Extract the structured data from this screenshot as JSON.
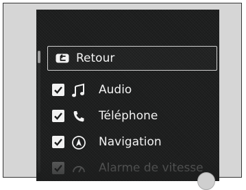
{
  "menu": {
    "back_label": "Retour",
    "items": [
      {
        "label": "Audio",
        "checked": true,
        "icon": "music-note-icon"
      },
      {
        "label": "Téléphone",
        "checked": true,
        "icon": "phone-icon"
      },
      {
        "label": "Navigation",
        "checked": true,
        "icon": "navigation-arrow-icon"
      },
      {
        "label": "Alarme de vitesse",
        "checked": true,
        "icon": "speed-alarm-icon"
      }
    ]
  },
  "colors": {
    "background": "#1b1c1c",
    "text": "#f2f2f2",
    "frame": "#d6d6d6"
  }
}
